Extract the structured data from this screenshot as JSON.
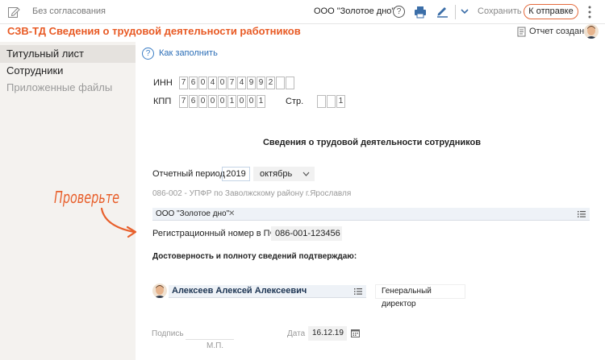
{
  "toolbar": {
    "status": "Без согласования",
    "organization": "ООО \"Золотое дно\"",
    "help_symbol": "?",
    "save_label": "Сохранить",
    "send_label": "К отправке"
  },
  "document": {
    "title": "СЗВ-ТД Сведения о трудовой деятельности работников",
    "report_status": "Отчет создан"
  },
  "sidebar": {
    "items": [
      {
        "label": "Титульный лист",
        "state": "active"
      },
      {
        "label": "Сотрудники",
        "state": "normal"
      },
      {
        "label": "Приложенные файлы",
        "state": "muted"
      }
    ]
  },
  "form": {
    "how_to_fill": "Как заполнить",
    "inn_label": "ИНН",
    "inn_digits": [
      "7",
      "6",
      "0",
      "4",
      "0",
      "7",
      "4",
      "9",
      "9",
      "2",
      "",
      ""
    ],
    "kpp_label": "КПП",
    "kpp_digits": [
      "7",
      "6",
      "0",
      "0",
      "0",
      "1",
      "0",
      "0",
      "1"
    ],
    "page_label": "Стр.",
    "page_digits": [
      "",
      "",
      "1"
    ],
    "heading": "Сведения о трудовой деятельности сотрудников",
    "period_label": "Отчетный период",
    "period_year": "2019",
    "period_month": "октябрь",
    "pfr_office": "086-002 - УПФР по Заволжскому району г.Ярославля",
    "organization_tag": "ООО \"Золотое дно\"",
    "remove_symbol": "✕",
    "regnum_label": "Регистрационный номер в ПФР",
    "regnum_value": "086-001-123456",
    "attest_label": "Достоверность и полноту сведений подтверждаю:",
    "signer_name": "Алексеев Алексей Алексеевич",
    "signer_position": "Генеральный директор",
    "signature_label": "Подпись",
    "stamp_label": "М.П.",
    "date_label": "Дата",
    "date_value": "16.12.19"
  },
  "annotation": {
    "text": "Проверьте"
  },
  "colors": {
    "accent": "#e85a24",
    "link": "#2a6db6",
    "sidebar_bg": "#f4f2ef",
    "field_bg": "#f1f1f1",
    "tag_bg": "#eef2f7"
  }
}
